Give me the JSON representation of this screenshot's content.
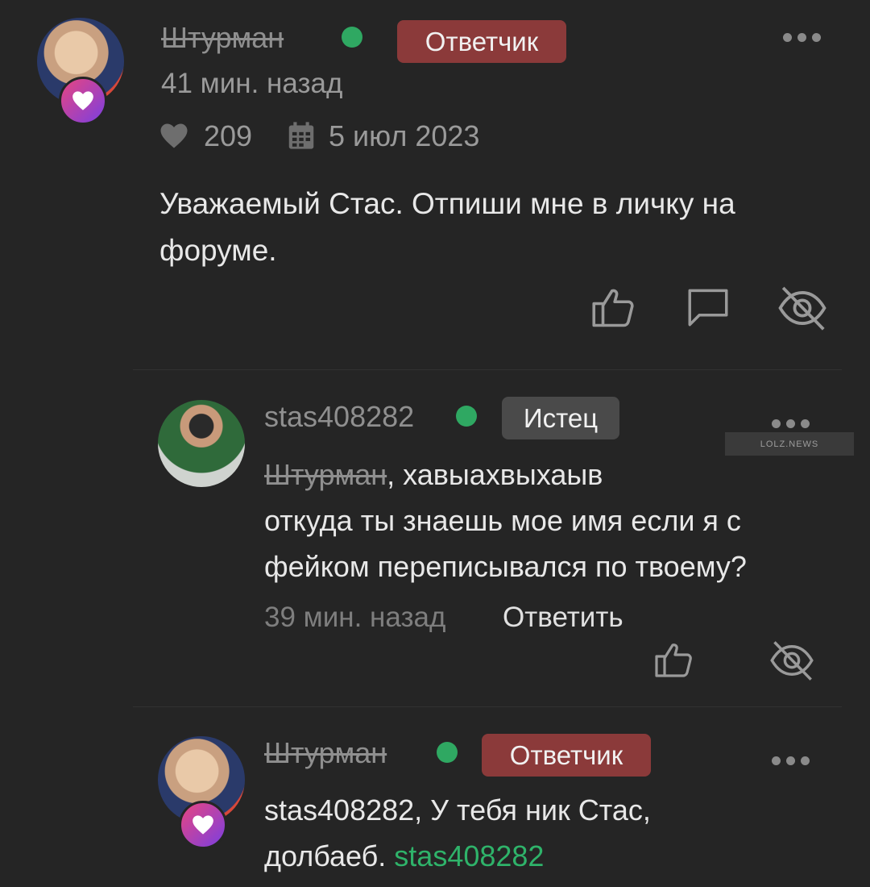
{
  "main_comment": {
    "author": "Штурман",
    "role": "Ответчик",
    "time": "41 мин. назад",
    "likes": "209",
    "date": "5 июл 2023",
    "text_line1": "Уважаемый Стас. Отпиши мне в личку на",
    "text_line2": "форуме."
  },
  "reply1": {
    "author": "stas408282",
    "role": "Истец",
    "mention": "Штурман",
    "text_after_mention": ", хавыахвыхаыв",
    "text_line2": "откуда ты знаешь мое имя если я с",
    "text_line3": "фейком переписывался по твоему?",
    "time": "39 мин. назад",
    "reply_label": "Ответить"
  },
  "reply2": {
    "author": "Штурман",
    "role": "Ответчик",
    "text_line1": "stas408282, У тебя ник Стас,",
    "text_line2_prefix": "долбаеб. ",
    "text_line2_link": "stas408282"
  },
  "watermark": {
    "text": "LOLZ.NEWS"
  },
  "colors": {
    "background": "#252525",
    "online": "#2fa862",
    "badge_defendant": "#8b3a3a",
    "badge_plaintiff": "#4a4a4a",
    "link_green": "#2fb36a"
  },
  "icons": [
    "heart-icon",
    "calendar-icon",
    "thumbs-up-icon",
    "comment-icon",
    "hide-icon",
    "more-icon"
  ]
}
